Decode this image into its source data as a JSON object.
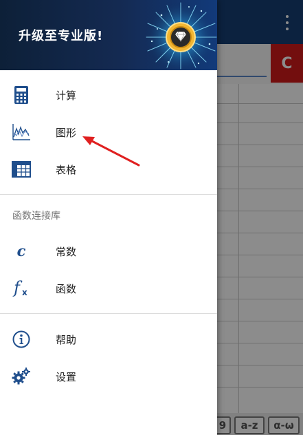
{
  "app": {
    "clear_button_label": "C",
    "keyboard_keys": [
      "9",
      "a-z",
      "α-ω"
    ]
  },
  "drawer": {
    "header": {
      "upgrade_text": "升级至专业版!"
    },
    "items": [
      {
        "label": "计算",
        "icon": "calculator-icon"
      },
      {
        "label": "图形",
        "icon": "graph-icon"
      },
      {
        "label": "表格",
        "icon": "table-icon"
      }
    ],
    "section_title": "函数连接库",
    "library_items": [
      {
        "label": "常数",
        "icon": "constant-c-icon"
      },
      {
        "label": "函数",
        "icon": "function-fx-icon"
      }
    ],
    "bottom_items": [
      {
        "label": "帮助",
        "icon": "info-icon"
      },
      {
        "label": "设置",
        "icon": "settings-gears-icon"
      }
    ]
  },
  "colors": {
    "brand_blue": "#173f73",
    "icon_blue": "#1f4e8c",
    "clear_red": "#d11b1b",
    "annotation_red": "#e02020",
    "badge_gold": "#f2b632"
  }
}
